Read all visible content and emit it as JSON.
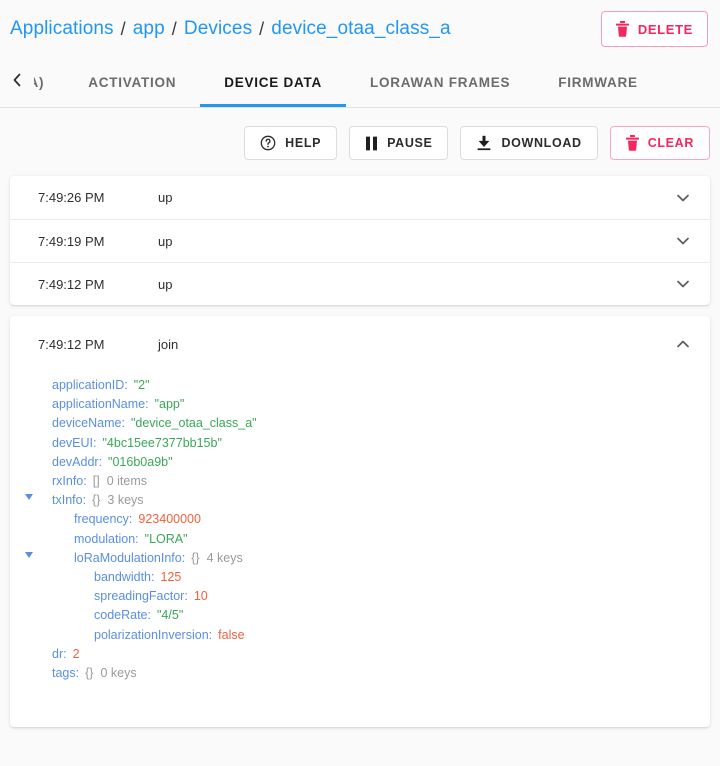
{
  "header": {
    "breadcrumb": [
      {
        "label": "Applications",
        "link": true
      },
      {
        "label": "app",
        "link": true
      },
      {
        "label": "Devices",
        "link": true
      },
      {
        "label": "device_otaa_class_a",
        "link": true
      }
    ],
    "separator": "/",
    "delete_button": {
      "label": "DELETE",
      "icon": "trash-icon",
      "color": "#f5255e"
    }
  },
  "tabs": {
    "scroll_left_icon": "chevron-left-icon",
    "items": [
      {
        "label": "AA)",
        "active": false,
        "clipped": true
      },
      {
        "label": "ACTIVATION",
        "active": false
      },
      {
        "label": "DEVICE DATA",
        "active": true
      },
      {
        "label": "LORAWAN FRAMES",
        "active": false
      },
      {
        "label": "FIRMWARE",
        "active": false
      }
    ],
    "active_underline_color": "#2196f3"
  },
  "toolbar": {
    "help": {
      "label": "HELP",
      "icon": "help-circle-icon"
    },
    "pause": {
      "label": "PAUSE",
      "icon": "pause-icon"
    },
    "download": {
      "label": "DOWNLOAD",
      "icon": "download-icon"
    },
    "clear": {
      "label": "CLEAR",
      "icon": "trash-icon",
      "color": "#f5255e"
    }
  },
  "events": [
    {
      "time": "7:49:26 PM",
      "type": "up",
      "expanded": false,
      "chevron": "chevron-down-icon"
    },
    {
      "time": "7:49:19 PM",
      "type": "up",
      "expanded": false,
      "chevron": "chevron-down-icon"
    },
    {
      "time": "7:49:12 PM",
      "type": "up",
      "expanded": false,
      "chevron": "chevron-down-icon"
    }
  ],
  "expanded_event": {
    "time": "7:49:12 PM",
    "type": "join",
    "chevron": "chevron-up-icon",
    "tree": [
      {
        "indent": 1,
        "key": "applicationID",
        "value": "\"2\"",
        "vtype": "string"
      },
      {
        "indent": 1,
        "key": "applicationName",
        "value": "\"app\"",
        "vtype": "string"
      },
      {
        "indent": 1,
        "key": "deviceName",
        "value": "\"device_otaa_class_a\"",
        "vtype": "string"
      },
      {
        "indent": 1,
        "key": "devEUI",
        "value": "\"4bc15ee7377bb15b\"",
        "vtype": "string"
      },
      {
        "indent": 1,
        "key": "devAddr",
        "value": "\"016b0a9b\"",
        "vtype": "string"
      },
      {
        "indent": 1,
        "key": "rxInfo",
        "brace": "[]",
        "meta": "0 items",
        "vtype": "array"
      },
      {
        "indent": 1,
        "key": "txInfo",
        "brace": "{}",
        "meta": "3 keys",
        "vtype": "object",
        "toggle": true
      },
      {
        "indent": 2,
        "key": "frequency",
        "value": "923400000",
        "vtype": "number"
      },
      {
        "indent": 2,
        "key": "modulation",
        "value": "\"LORA\"",
        "vtype": "string"
      },
      {
        "indent": 2,
        "key": "loRaModulationInfo",
        "brace": "{}",
        "meta": "4 keys",
        "vtype": "object",
        "toggle": true
      },
      {
        "indent": 3,
        "key": "bandwidth",
        "value": "125",
        "vtype": "number"
      },
      {
        "indent": 3,
        "key": "spreadingFactor",
        "value": "10",
        "vtype": "number"
      },
      {
        "indent": 3,
        "key": "codeRate",
        "value": "\"4/5\"",
        "vtype": "string"
      },
      {
        "indent": 3,
        "key": "polarizationInversion",
        "value": "false",
        "vtype": "boolean"
      },
      {
        "indent": 1,
        "key": "dr",
        "value": "2",
        "vtype": "number"
      },
      {
        "indent": 1,
        "key": "tags",
        "brace": "{}",
        "meta": "0 keys",
        "vtype": "object"
      }
    ]
  },
  "colors": {
    "accent_blue": "#2196f3",
    "danger_pink": "#f5255e",
    "json_key": "#5a8fe0",
    "json_string": "#3aa758",
    "json_number": "#f4603c",
    "page_bg": "#fafafa"
  }
}
